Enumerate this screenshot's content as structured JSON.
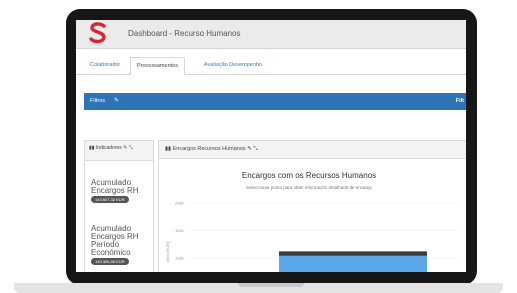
{
  "header": {
    "title": "Dashboard - Recurso Humanos",
    "logo_color": "#d9232d"
  },
  "tabs": [
    {
      "label": "Colaborador"
    },
    {
      "label": "Processamentos"
    },
    {
      "label": "Avaliação Desempenho"
    }
  ],
  "filters": {
    "label": "Filtros",
    "right_label": "Filt"
  },
  "indicators": {
    "title": "Indicadores",
    "kpis": [
      {
        "label": "Acumulado Encargos RH",
        "value": "143.607,32 EUR"
      },
      {
        "label": "Acumulado Encargos RH Período Económico",
        "value": "149.306,99 EUR"
      }
    ]
  },
  "chart_panel": {
    "title": "Encargos Recursos Humanos",
    "chart_title": "Encargos com os Recursos Humanos",
    "chart_subtitle": "Seleccionar ponto para obter informação detalhada de encargo",
    "ylabel": "Valor (EUR)"
  },
  "chart_data": {
    "type": "bar",
    "title": "Encargos com os Recursos Humanos",
    "ylabel": "Valor (EUR)",
    "yticks": [
      "200k",
      "150k",
      "100k"
    ],
    "ylim": [
      0,
      200000
    ],
    "series": [
      {
        "values": [
          104000
        ],
        "color": "#5aa6e6"
      },
      {
        "values": [
          8000
        ],
        "color": "#3b3b3b"
      }
    ],
    "colors": {
      "primary": "#5aa6e6",
      "dark": "#3b3b3b"
    }
  }
}
